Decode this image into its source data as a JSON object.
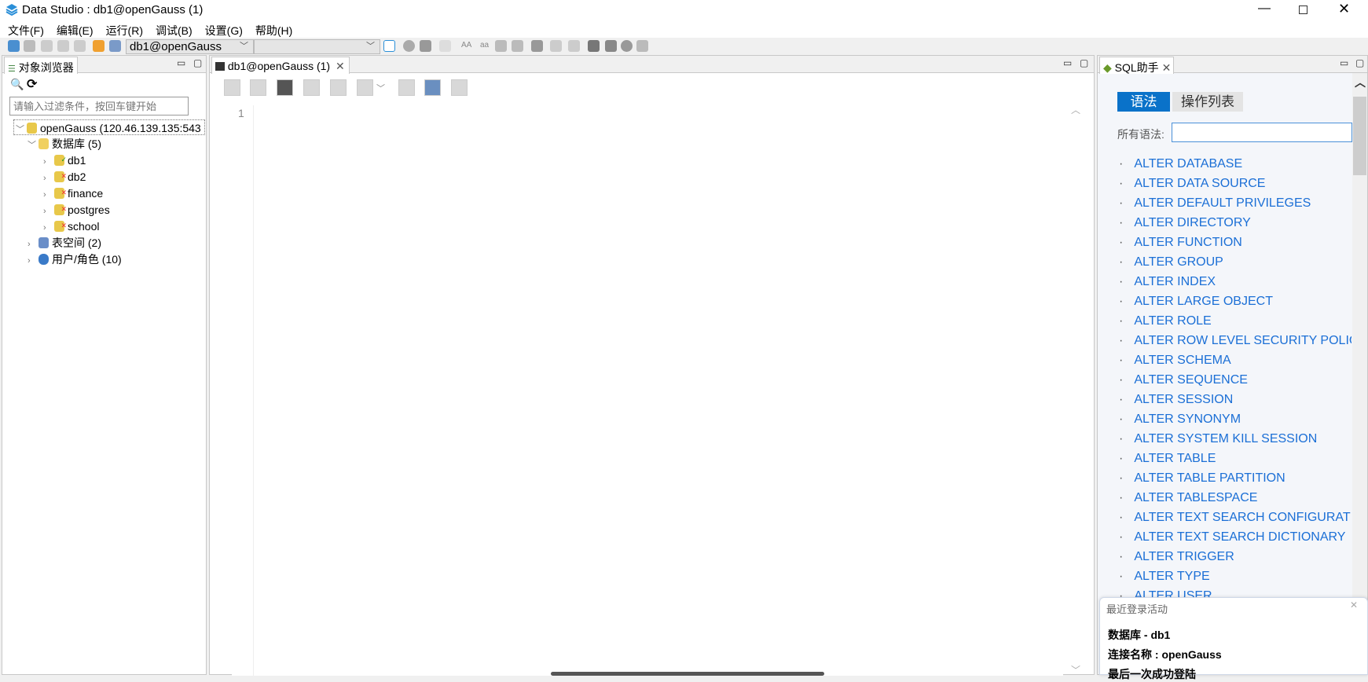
{
  "window": {
    "title": "Data Studio : db1@openGauss (1)",
    "controls": [
      "minimize",
      "restore",
      "close"
    ]
  },
  "menu": [
    "文件(F)",
    "编辑(E)",
    "运行(R)",
    "调试(B)",
    "设置(G)",
    "帮助(H)"
  ],
  "toolbar": {
    "connection_select": "db1@openGauss",
    "second_select": ""
  },
  "object_browser": {
    "tab_label": "对象浏览器",
    "filter_placeholder": "请输入过滤条件，按回车键开始",
    "tree": {
      "server": "openGauss (120.46.139.135:543",
      "databases_label": "数据库 (5)",
      "databases": [
        {
          "name": "db1",
          "connected": true
        },
        {
          "name": "db2",
          "connected": false
        },
        {
          "name": "finance",
          "connected": false
        },
        {
          "name": "postgres",
          "connected": false
        },
        {
          "name": "school",
          "connected": false
        }
      ],
      "tablespaces_label": "表空间 (2)",
      "users_label": "用户/角色 (10)"
    }
  },
  "editor": {
    "tab_label": "db1@openGauss (1)",
    "line_numbers": [
      "1"
    ]
  },
  "sql_assistant": {
    "tab_label": "SQL助手",
    "tabs": [
      {
        "label": "语法",
        "active": true
      },
      {
        "label": "操作列表",
        "active": false
      }
    ],
    "filter_label": "所有语法:",
    "filter_value": "",
    "items": [
      "ALTER DATABASE",
      "ALTER DATA SOURCE",
      "ALTER DEFAULT PRIVILEGES",
      "ALTER DIRECTORY",
      "ALTER FUNCTION",
      "ALTER GROUP",
      "ALTER INDEX",
      "ALTER LARGE OBJECT",
      "ALTER ROLE",
      "ALTER ROW LEVEL SECURITY POLICY",
      "ALTER SCHEMA",
      "ALTER SEQUENCE",
      "ALTER SESSION",
      "ALTER SYNONYM",
      "ALTER SYSTEM KILL SESSION",
      "ALTER TABLE",
      "ALTER TABLE PARTITION",
      "ALTER TABLESPACE",
      "ALTER TEXT SEARCH CONFIGURATIC",
      "ALTER TEXT SEARCH DICTIONARY",
      "ALTER TRIGGER",
      "ALTER TYPE",
      "ALTER USER"
    ],
    "accent": "#0a72c9"
  },
  "login_popup": {
    "title": "最近登录活动",
    "database": "数据库 - db1",
    "connection": "连接名称 : openGauss",
    "last_login": "最后一次成功登陆"
  }
}
